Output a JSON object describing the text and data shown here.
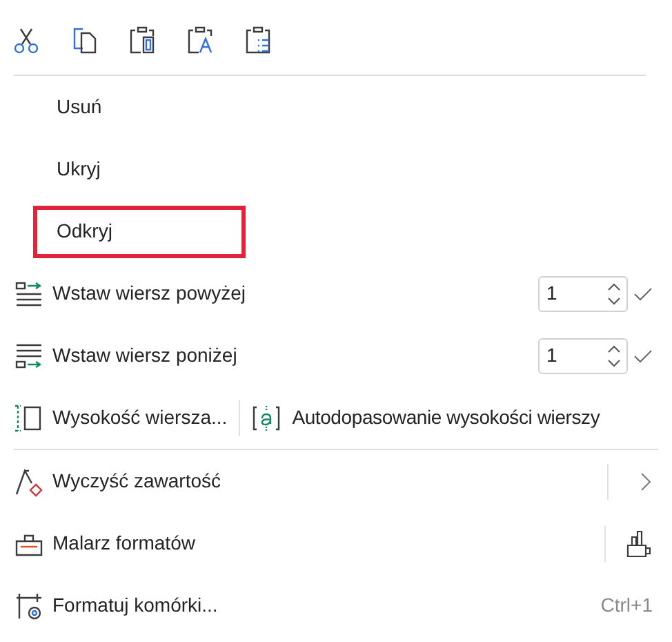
{
  "menu": [
    {
      "kind": "plain",
      "label": "Usuń",
      "highlighted": false
    },
    {
      "kind": "plain",
      "label": "Ukryj",
      "highlighted": false
    },
    {
      "kind": "plain",
      "label": "Odkryj",
      "highlighted": true
    },
    {
      "kind": "spin",
      "label": "Wstaw wiersz powyżej",
      "value": "1"
    },
    {
      "kind": "spin",
      "label": "Wstaw wiersz poniżej",
      "value": "1"
    },
    {
      "kind": "split",
      "label": "Wysokość wiersza...",
      "second_label": "Autodopasowanie wysokości wierszy"
    },
    {
      "kind": "divider"
    },
    {
      "kind": "submenu",
      "label": "Wyczyść zawartość"
    },
    {
      "kind": "tool",
      "label": "Malarz formatów"
    },
    {
      "kind": "shortcut",
      "label": "Formatuj komórki...",
      "shortcut": "Ctrl+1"
    }
  ]
}
